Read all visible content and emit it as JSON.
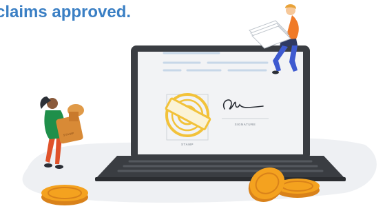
{
  "headline": "claims approved.",
  "document": {
    "stamp_caption": "STAMP",
    "signature_caption": "SIGNATURE",
    "held_stamp_text": "STAMP"
  },
  "colors": {
    "headline": "#3a7fc4",
    "stamp_gold": "#f2c23a",
    "laptop_body": "#3a3d42",
    "coin_orange": "#f4a21f",
    "screen_line": "#c7d7e8"
  },
  "icons": [
    "stamp-icon",
    "signature-icon",
    "coin-icon"
  ]
}
